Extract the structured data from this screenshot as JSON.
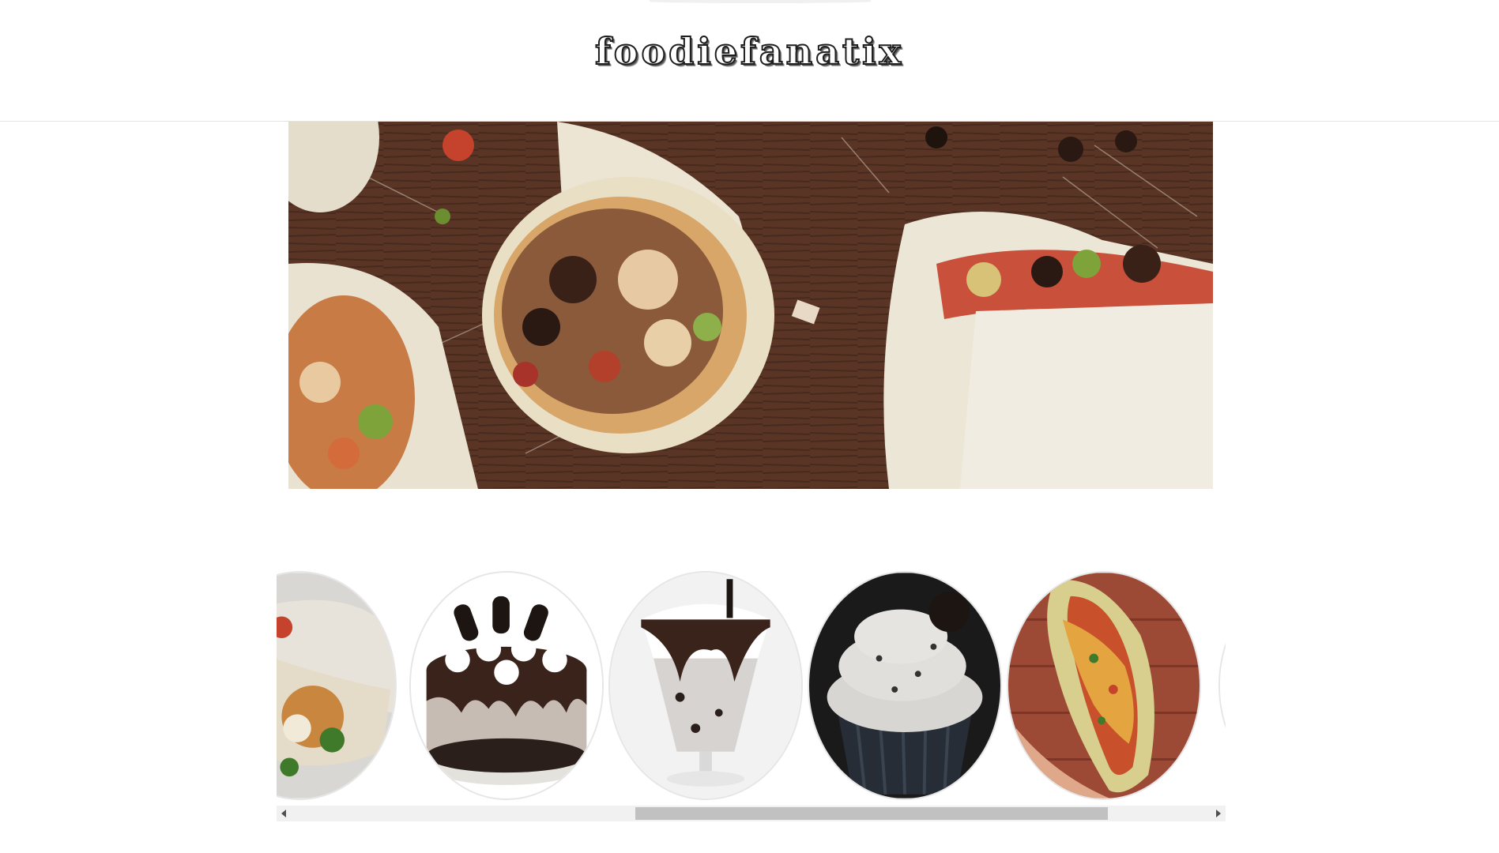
{
  "header": {
    "logo_text": "foodiefanatix"
  },
  "hero": {
    "image_name": "wraps-hero-image"
  },
  "carousel": {
    "items": [
      {
        "name": "wraps-thumbnail"
      },
      {
        "name": "oreo-cake-thumbnail"
      },
      {
        "name": "oreo-milkshake-thumbnail"
      },
      {
        "name": "oreo-cupcake-thumbnail"
      },
      {
        "name": "loaded-hotdog-thumbnail"
      },
      {
        "name": "next-thumbnail-partial"
      }
    ],
    "scroll_position": 0.38
  },
  "colors": {
    "background": "#ffffff",
    "header_border": "#e3e3e3",
    "scrollbar_track": "#f1f1f1",
    "scrollbar_thumb": "#c1c1c1"
  }
}
